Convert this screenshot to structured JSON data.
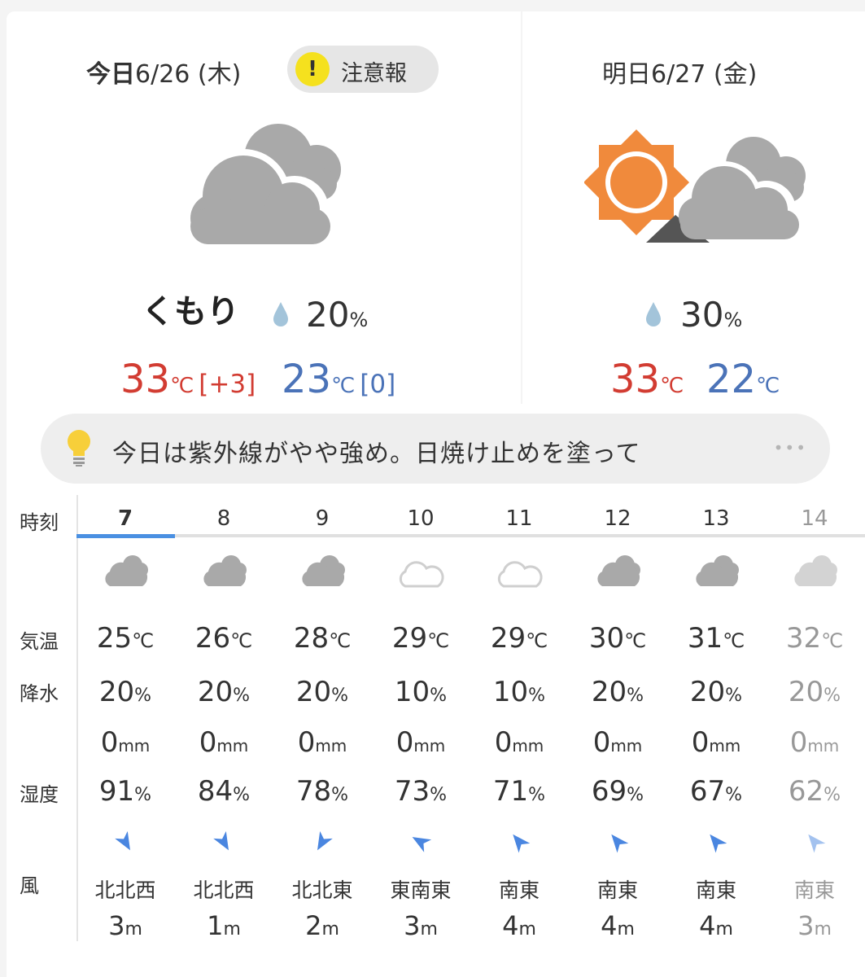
{
  "today": {
    "label": "今日",
    "date": "6/26 (木)",
    "alert_icon": "!",
    "alert_label": "注意報",
    "weather": "くもり",
    "pop": "20",
    "pop_unit": "%",
    "high": "33",
    "high_diff": "[+3]",
    "low": "23",
    "low_diff": "[0]",
    "temp_unit": "℃"
  },
  "tomorrow": {
    "label": "明日",
    "date": "6/27 (金)",
    "pop": "30",
    "pop_unit": "%",
    "high": "33",
    "low": "22",
    "temp_unit": "℃"
  },
  "tip": {
    "text": "今日は紫外線がやや強め。日焼け止めを塗って",
    "more": "•••"
  },
  "labels": {
    "time": "時刻",
    "temp": "気温",
    "precip": "降水",
    "humidity": "湿度",
    "wind": "風"
  },
  "units": {
    "temp": "℃",
    "percent": "%",
    "mm": "mm",
    "m": "m"
  },
  "hourly": [
    {
      "hour": "7",
      "icon": "cloudy-icon",
      "temp": "25",
      "pop": "20",
      "rain": "0",
      "humidity": "91",
      "wind_dir": "北北西",
      "wind_speed": "3",
      "arrow_deg": 150
    },
    {
      "hour": "8",
      "icon": "cloudy-icon",
      "temp": "26",
      "pop": "20",
      "rain": "0",
      "humidity": "84",
      "wind_dir": "北北西",
      "wind_speed": "1",
      "arrow_deg": 150
    },
    {
      "hour": "9",
      "icon": "cloudy-icon",
      "temp": "28",
      "pop": "20",
      "rain": "0",
      "humidity": "78",
      "wind_dir": "北北東",
      "wind_speed": "2",
      "arrow_deg": 210
    },
    {
      "hour": "10",
      "icon": "light-cloud-icon",
      "temp": "29",
      "pop": "10",
      "rain": "0",
      "humidity": "73",
      "wind_dir": "東南東",
      "wind_speed": "3",
      "arrow_deg": 300
    },
    {
      "hour": "11",
      "icon": "light-cloud-icon",
      "temp": "29",
      "pop": "10",
      "rain": "0",
      "humidity": "71",
      "wind_dir": "南東",
      "wind_speed": "4",
      "arrow_deg": 320
    },
    {
      "hour": "12",
      "icon": "cloudy-icon",
      "temp": "30",
      "pop": "20",
      "rain": "0",
      "humidity": "69",
      "wind_dir": "南東",
      "wind_speed": "4",
      "arrow_deg": 320
    },
    {
      "hour": "13",
      "icon": "cloudy-icon",
      "temp": "31",
      "pop": "20",
      "rain": "0",
      "humidity": "67",
      "wind_dir": "南東",
      "wind_speed": "4",
      "arrow_deg": 320
    },
    {
      "hour": "14",
      "icon": "cloudy-icon",
      "temp": "32",
      "pop": "20",
      "rain": "0",
      "humidity": "62",
      "wind_dir": "南東",
      "wind_speed": "3",
      "arrow_deg": 320,
      "faded": true
    }
  ],
  "colors": {
    "high": "#d23c32",
    "low": "#4b73b8",
    "accent": "#4a90e2",
    "cloud": "#a9a9a9",
    "sun": "#f08a3c",
    "alert": "#f5e11e"
  }
}
